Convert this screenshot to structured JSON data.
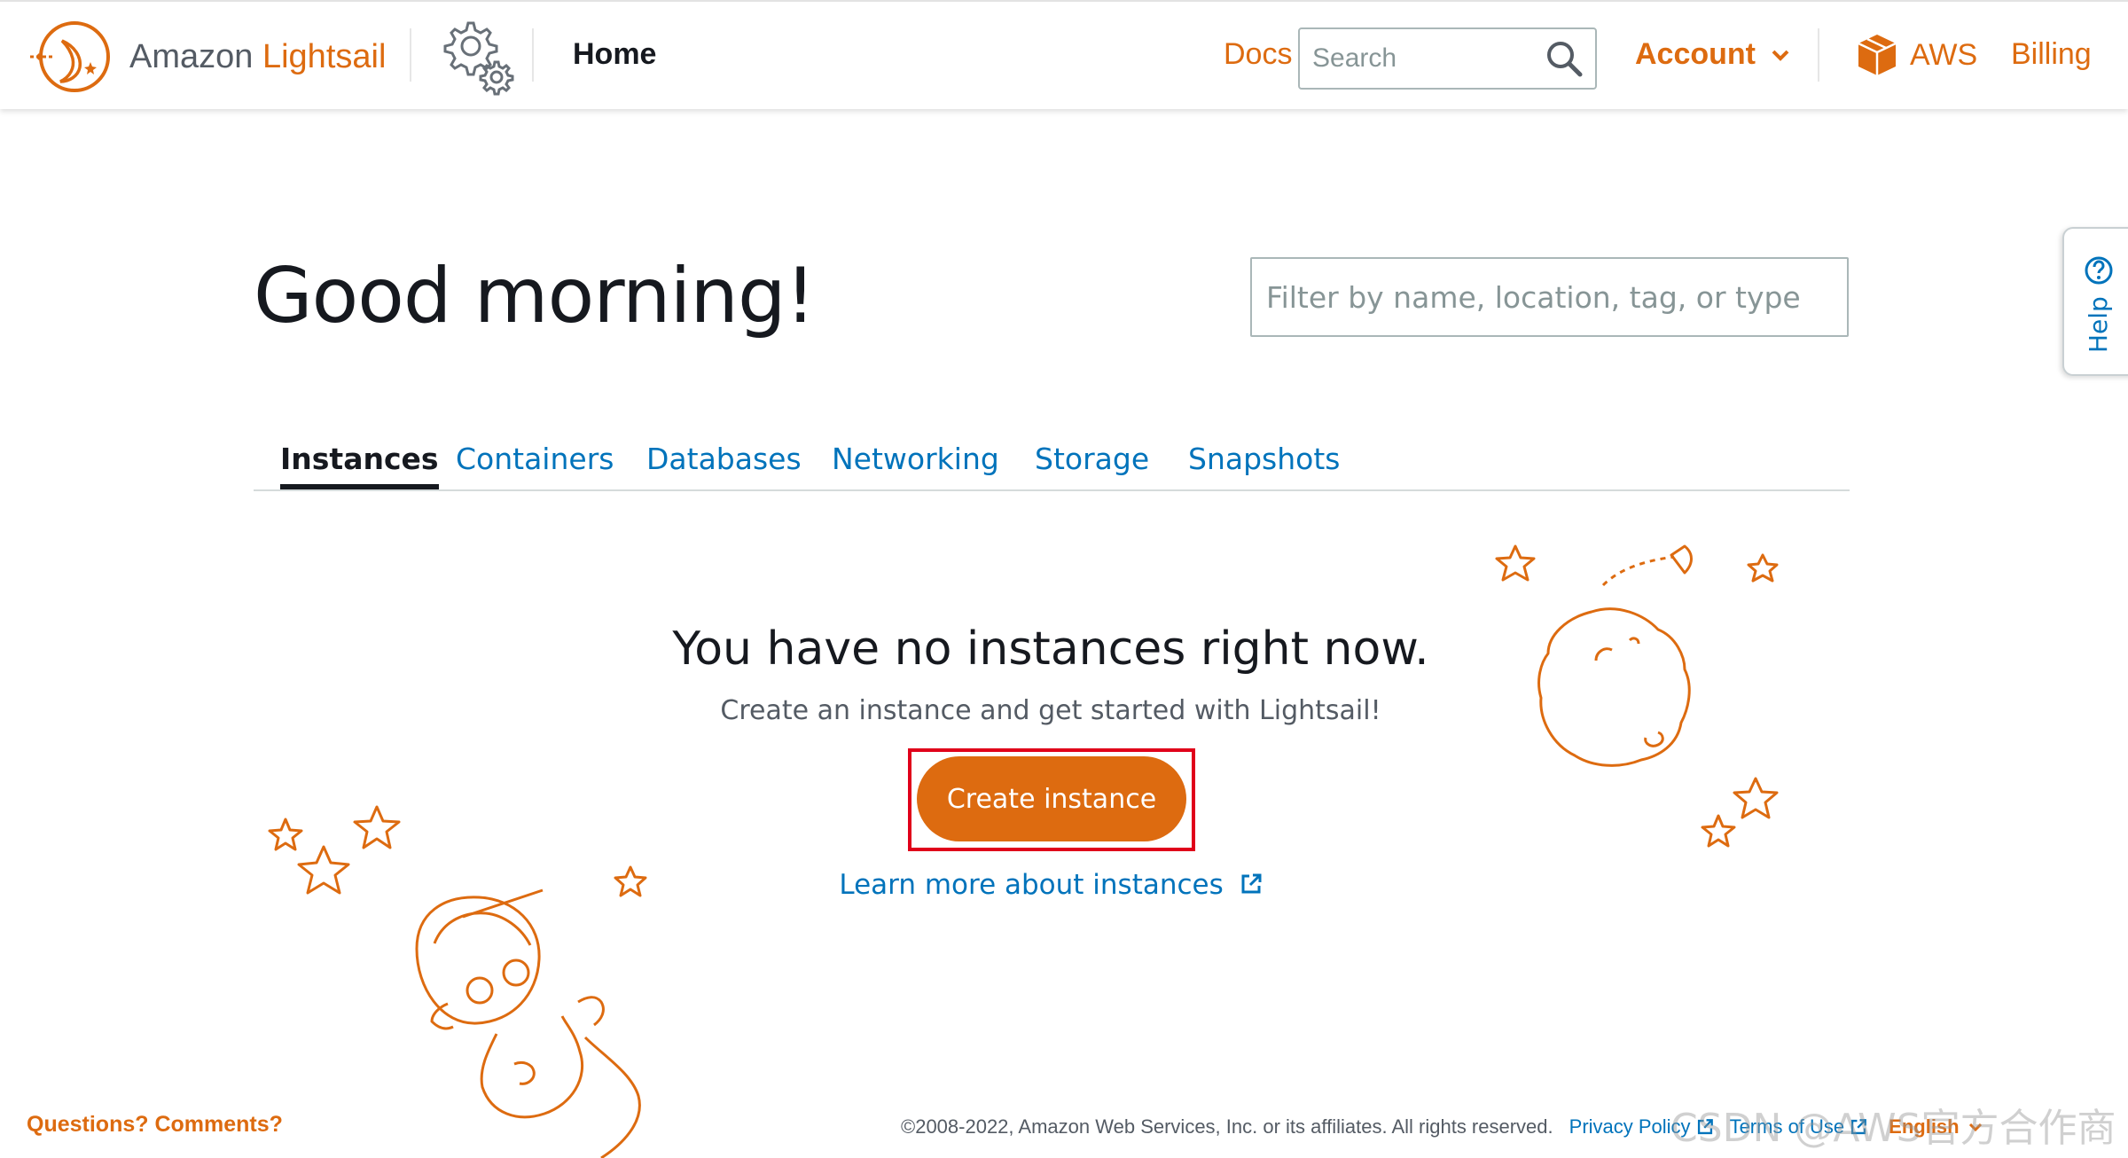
{
  "brand": {
    "prefix": "Amazon",
    "name": "Lightsail"
  },
  "header": {
    "page_title": "Home",
    "docs_label": "Docs",
    "search_placeholder": "Search",
    "account_label": "Account",
    "aws_label": "AWS",
    "billing_label": "Billing"
  },
  "main": {
    "greeting": "Good morning!",
    "filter_placeholder": "Filter by name, location, tag, or type",
    "tabs": [
      {
        "label": "Instances",
        "active": true
      },
      {
        "label": "Containers",
        "active": false
      },
      {
        "label": "Databases",
        "active": false
      },
      {
        "label": "Networking",
        "active": false
      },
      {
        "label": "Storage",
        "active": false
      },
      {
        "label": "Snapshots",
        "active": false
      }
    ],
    "empty_title": "You have no instances right now.",
    "empty_subtitle": "Create an instance and get started with Lightsail!",
    "create_button": "Create instance",
    "learn_more": "Learn more about instances"
  },
  "help_tab": {
    "label": "Help"
  },
  "footer": {
    "questions": "Questions? Comments?",
    "copyright": "©2008-2022, Amazon Web Services, Inc. or its affiliates. All rights reserved.",
    "privacy": "Privacy Policy",
    "terms": "Terms of Use",
    "language": "English"
  },
  "watermark": "CSDN @AWS官方合作商",
  "colors": {
    "accent": "#dd6b10",
    "link": "#0073bb",
    "text": "#16191f",
    "highlight": "#e0001a"
  }
}
